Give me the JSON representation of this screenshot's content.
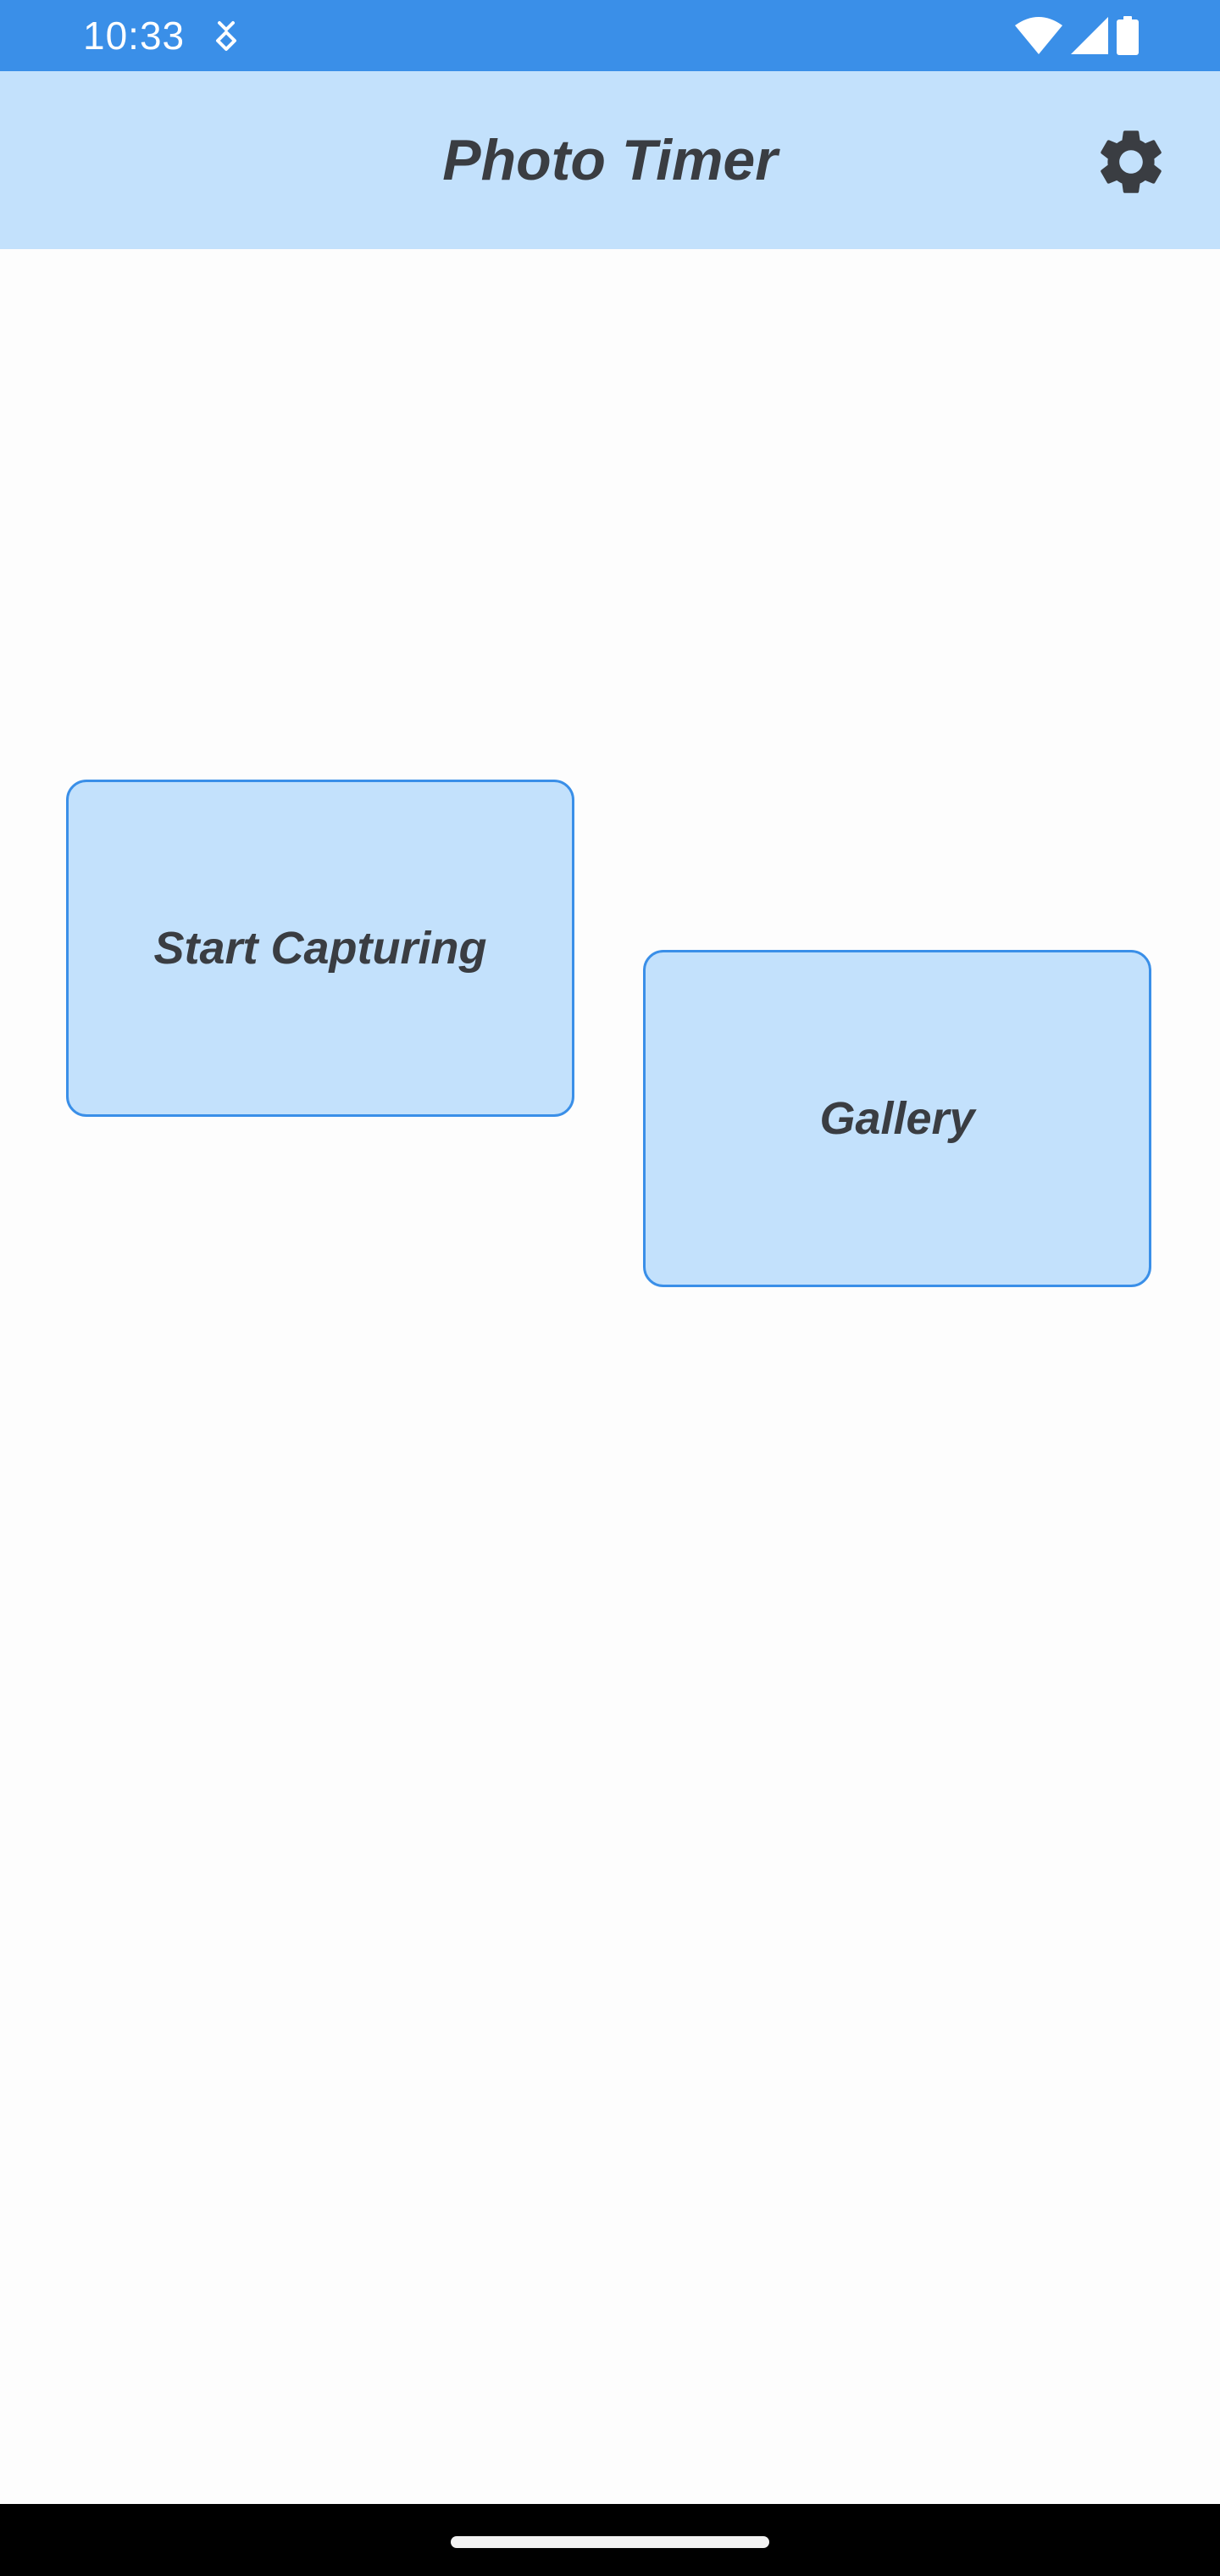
{
  "status_bar": {
    "time": "10:33",
    "icons": [
      "debug-icon",
      "wifi-icon",
      "signal-icon",
      "battery-icon"
    ]
  },
  "app_bar": {
    "title": "Photo Timer",
    "settings_icon": "gear-icon"
  },
  "actions": {
    "start_label": "Start Capturing",
    "gallery_label": "Gallery"
  },
  "colors": {
    "status_bar": "#3a8fe8",
    "app_bar": "#c3e1fc",
    "card_fill": "#c3e1fc",
    "card_border": "#3a8fe8",
    "text": "#3a3d42",
    "background": "#fdfdfd"
  }
}
